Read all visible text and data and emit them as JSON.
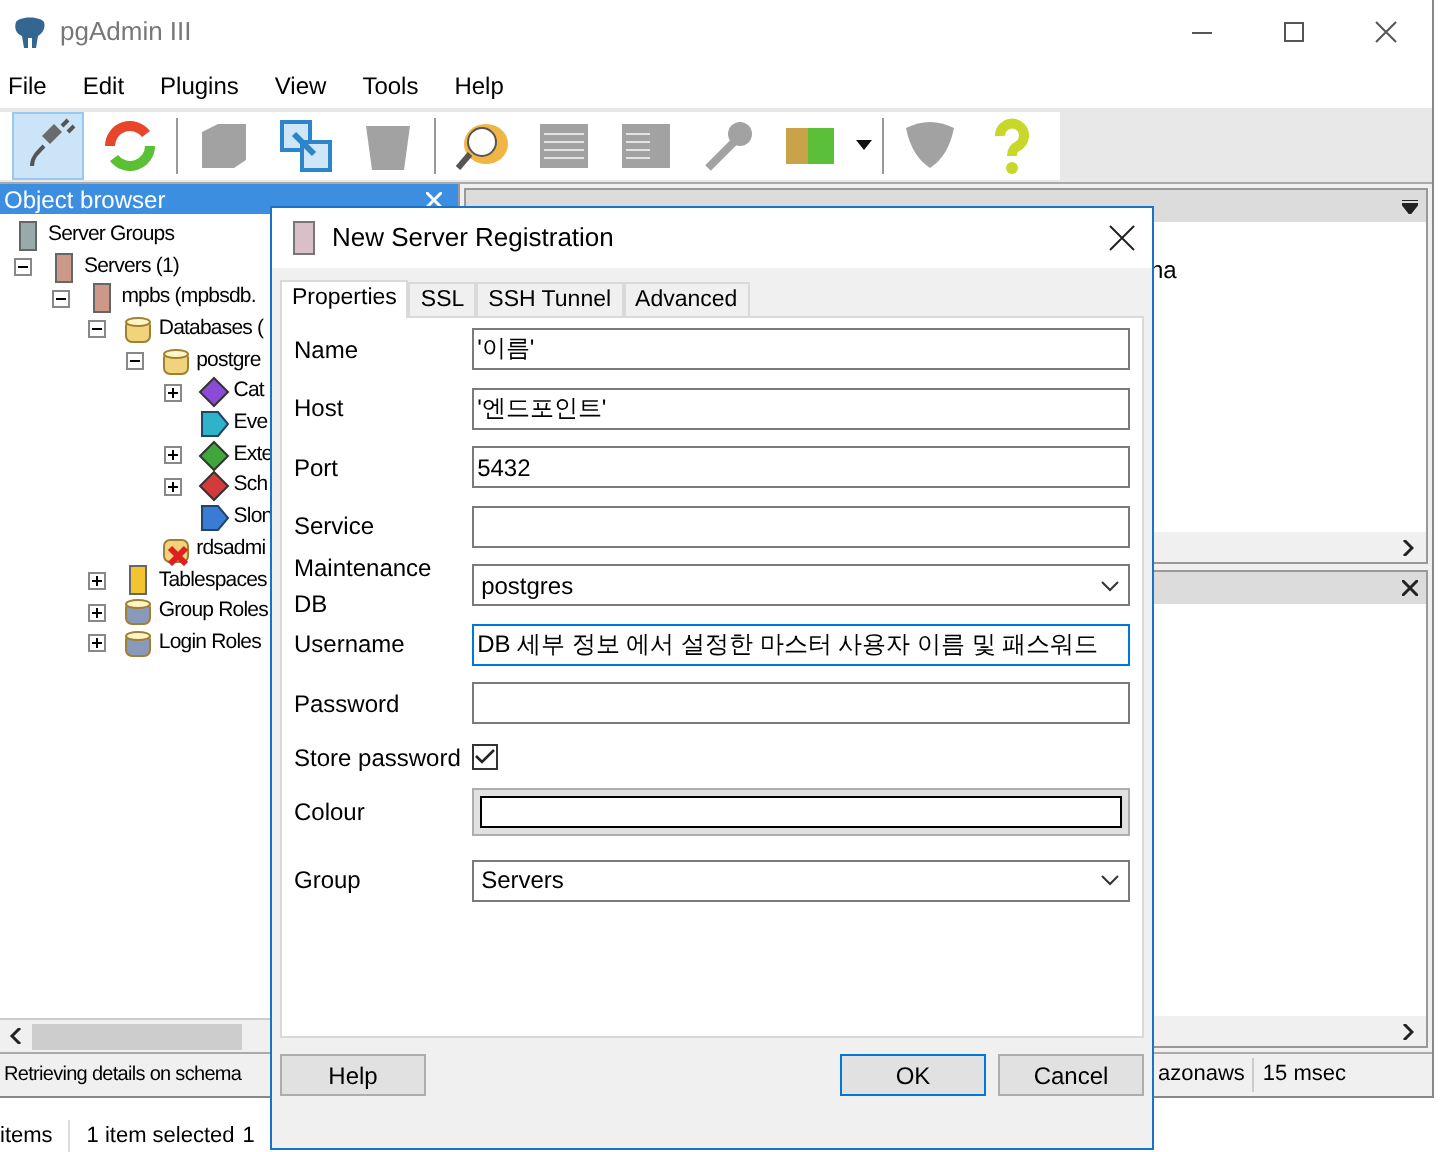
{
  "window": {
    "title": "pgAdmin III"
  },
  "menu": [
    "File",
    "Edit",
    "Plugins",
    "View",
    "Tools",
    "Help"
  ],
  "toolbar": [
    {
      "kind": "connect",
      "disabled": false,
      "selected": true
    },
    {
      "kind": "refresh",
      "disabled": false,
      "selected": false
    },
    {
      "kind": "object",
      "disabled": true,
      "selected": false
    },
    {
      "kind": "copy",
      "disabled": false,
      "selected": false
    },
    {
      "kind": "trash",
      "disabled": true,
      "selected": false
    },
    {
      "kind": "sql",
      "disabled": false,
      "selected": false
    },
    {
      "kind": "table",
      "disabled": true,
      "selected": false
    },
    {
      "kind": "table-filter",
      "disabled": true,
      "selected": false
    },
    {
      "kind": "wrench",
      "disabled": true,
      "selected": false
    },
    {
      "kind": "plugins",
      "disabled": false,
      "selected": false
    },
    {
      "kind": "shield",
      "disabled": true,
      "selected": false
    },
    {
      "kind": "help",
      "disabled": false,
      "selected": false
    }
  ],
  "object_browser": {
    "title": "Object browser",
    "tree": [
      {
        "label": "Server Groups",
        "kind": "server-group",
        "children": [
          {
            "label": "Servers (1)",
            "kind": "server",
            "expanded": true,
            "children": [
              {
                "label": "mpbs (mpbsdb.",
                "kind": "server",
                "expanded": true,
                "children": [
                  {
                    "label": "Databases (",
                    "kind": "databases",
                    "expanded": true,
                    "children": [
                      {
                        "label": "postgre",
                        "kind": "database",
                        "expanded": true,
                        "children": [
                          {
                            "label": "Cat",
                            "kind": "catalog",
                            "expanded": false
                          },
                          {
                            "label": "Eve",
                            "kind": "event"
                          },
                          {
                            "label": "Exte",
                            "kind": "extension",
                            "expanded": false
                          },
                          {
                            "label": "Sch",
                            "kind": "schema",
                            "expanded": false
                          },
                          {
                            "label": "Slon",
                            "kind": "slony"
                          }
                        ]
                      },
                      {
                        "label": "rdsadmi",
                        "kind": "database-error"
                      }
                    ]
                  },
                  {
                    "label": "Tablespaces",
                    "kind": "tablespace",
                    "expanded": false
                  },
                  {
                    "label": "Group Roles",
                    "kind": "group-role",
                    "expanded": false
                  },
                  {
                    "label": "Login Roles",
                    "kind": "login-role",
                    "expanded": false
                  }
                ]
              }
            ]
          }
        ]
      }
    ]
  },
  "properties_panel": {
    "text": "na"
  },
  "status_bar": [
    "Retrieving details on schema",
    "azonaws",
    "15 msec"
  ],
  "explorer_status": [
    "items",
    "1 item selected",
    "1"
  ],
  "dialog": {
    "title": "New Server Registration",
    "tabs": [
      {
        "label": "Properties",
        "selected": true
      },
      {
        "label": "SSL",
        "selected": false
      },
      {
        "label": "SSH Tunnel",
        "selected": false
      },
      {
        "label": "Advanced",
        "selected": false
      }
    ],
    "fields": [
      {
        "label": "Name",
        "kind": "text",
        "value": "'이름'",
        "focused": false
      },
      {
        "label": "Host",
        "kind": "text",
        "value": "'엔드포인트'",
        "focused": false
      },
      {
        "label": "Port",
        "kind": "text",
        "value": "5432",
        "focused": false
      },
      {
        "label": "Service",
        "kind": "text",
        "focused": false
      },
      {
        "label": "Maintenance DB",
        "kind": "combo",
        "value": "postgres",
        "focused": false
      },
      {
        "label": "Username",
        "kind": "text",
        "value": "DB 세부 정보 에서 설정한 마스터 사용자 이름 및 패스워드",
        "focused": true
      },
      {
        "label": "Password",
        "kind": "text",
        "focused": false
      },
      {
        "label": "Store password",
        "kind": "checkbox",
        "checked": true
      },
      {
        "label": "Colour",
        "kind": "colour",
        "color": "#ffffff"
      },
      {
        "label": "Group",
        "kind": "combo",
        "value": "Servers",
        "focused": false
      }
    ],
    "buttons": [
      {
        "label": "Help",
        "kind": "normal"
      },
      {
        "label": "OK",
        "kind": "default"
      },
      {
        "label": "Cancel",
        "kind": "normal"
      }
    ]
  }
}
